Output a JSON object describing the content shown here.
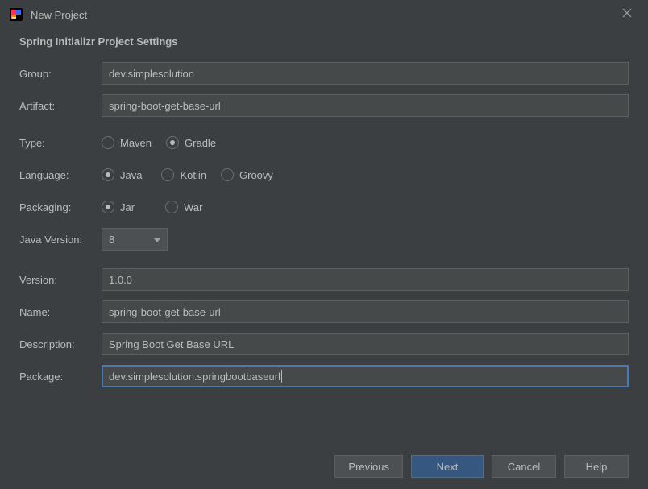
{
  "window": {
    "title": "New Project"
  },
  "heading": "Spring Initializr Project Settings",
  "labels": {
    "group": "Group:",
    "artifact": "Artifact:",
    "type": "Type:",
    "language": "Language:",
    "packaging": "Packaging:",
    "javaVersion": "Java Version:",
    "version": "Version:",
    "name": "Name:",
    "description": "Description:",
    "package": "Package:"
  },
  "fields": {
    "group": "dev.simplesolution",
    "artifact": "spring-boot-get-base-url",
    "version": "1.0.0",
    "name": "spring-boot-get-base-url",
    "description": "Spring Boot Get Base URL",
    "package": "dev.simplesolution.springbootbaseurl"
  },
  "type": {
    "options": [
      "Maven",
      "Gradle"
    ],
    "selected": "Gradle",
    "maven": "Maven",
    "gradle": "Gradle"
  },
  "language": {
    "options": [
      "Java",
      "Kotlin",
      "Groovy"
    ],
    "selected": "Java",
    "java": "Java",
    "kotlin": "Kotlin",
    "groovy": "Groovy"
  },
  "packaging": {
    "options": [
      "Jar",
      "War"
    ],
    "selected": "Jar",
    "jar": "Jar",
    "war": "War"
  },
  "javaVersion": {
    "selected": "8"
  },
  "buttons": {
    "previous": "Previous",
    "next": "Next",
    "cancel": "Cancel",
    "help": "Help"
  }
}
